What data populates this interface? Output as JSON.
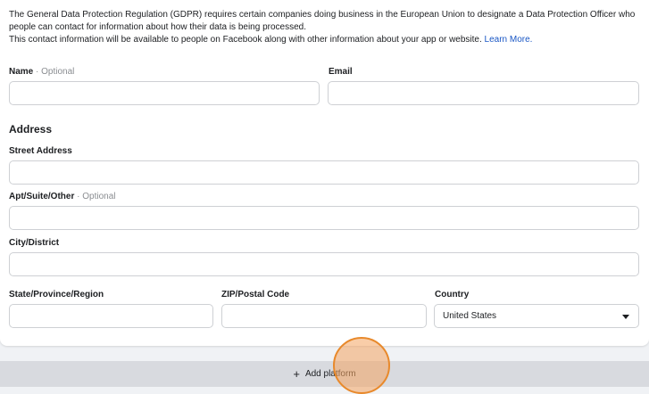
{
  "intro": {
    "line1": "The General Data Protection Regulation (GDPR) requires certain companies doing business in the European Union to designate a Data Protection Officer who people can contact for information about how their data is being processed.",
    "line2": "This contact information will be available to people on Facebook along with other information about your app or website.",
    "learn_more": "Learn More."
  },
  "fields": {
    "name_label": "Name",
    "optional_suffix": "· Optional",
    "email_label": "Email",
    "address_heading": "Address",
    "street_label": "Street Address",
    "apt_label": "Apt/Suite/Other",
    "city_label": "City/District",
    "state_label": "State/Province/Region",
    "zip_label": "ZIP/Postal Code",
    "country_label": "Country",
    "country_value": "United States"
  },
  "footer": {
    "add_platform_label": "Add platform",
    "plus_glyph": "+"
  },
  "colors": {
    "link": "#1a57c5",
    "marker": "#f4a460"
  }
}
